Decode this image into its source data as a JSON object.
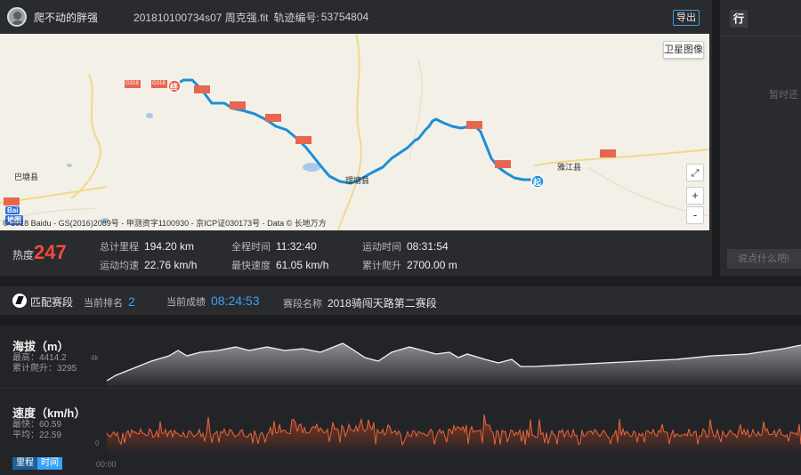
{
  "header": {
    "user_name": "爬不动的胖强",
    "file_name": "201810100734s07 周克强.fit",
    "track_label": "轨迹编号:",
    "track_id": "53754804",
    "export_label": "导出"
  },
  "map": {
    "satellite_label": "卫星图像",
    "zoom_in": "+",
    "zoom_out": "-",
    "fullscreen_icon": "expand-icon",
    "copyright": "© 2018 Baidu - GS(2016)2089号 - 甲测资字1100930 - 京ICP证030173号 - Data © 长地万方",
    "logo_text": "Bai",
    "logo_badge": "地图",
    "place_labels": [
      "巴塘县",
      "理塘县",
      "雅江县"
    ],
    "road_label": "G318",
    "road_label_alt": "G318",
    "start_marker": "起",
    "end_marker": "终",
    "route_color": "#1a8fd6"
  },
  "stats": {
    "heat_label": "热度",
    "heat_value": "247",
    "total_distance_label": "总计里程",
    "total_distance_value": "194.20 km",
    "total_time_label": "全程时间",
    "total_time_value": "11:32:40",
    "moving_time_label": "运动时间",
    "moving_time_value": "08:31:54",
    "avg_speed_label": "运动均速",
    "avg_speed_value": "22.76 km/h",
    "max_speed_label": "最快速度",
    "max_speed_value": "61.05 km/h",
    "total_climb_label": "累计爬升",
    "total_climb_value": "2700.00 m"
  },
  "side": {
    "tab_label": "行",
    "empty_text": "暂时还",
    "comment_placeholder": "说点什么吧!"
  },
  "segment": {
    "title": "匹配赛段",
    "rank_label": "当前排名",
    "rank_value": "2",
    "score_label": "当前成绩",
    "score_value": "08:24:53",
    "name_label": "赛段名称",
    "name_value": "2018骑闯天路第二赛段"
  },
  "charts": {
    "altitude": {
      "title": "海拔（m）",
      "max_text": "最高：4414.2",
      "climb_text": "累计爬升：3295",
      "tick_label": "4k"
    },
    "speed": {
      "title": "速度（km/h）",
      "max_text": "最快：60.59",
      "avg_text": "平均：22.59",
      "tick_label": "0",
      "line_color": "#e8663d"
    },
    "mode_distance": "里程",
    "mode_time": "时间",
    "time_start": "00:00"
  }
}
